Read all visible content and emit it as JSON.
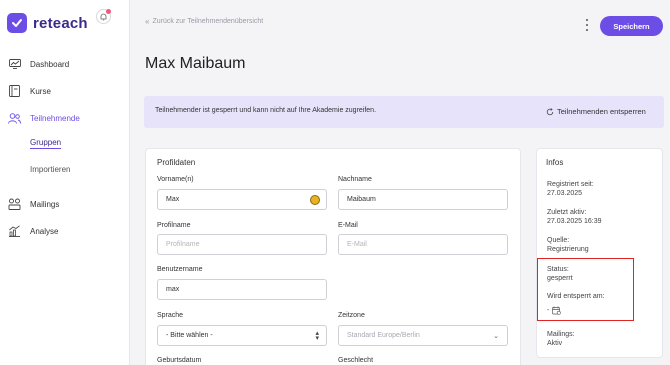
{
  "app": {
    "brand": "reteach"
  },
  "sidebar": {
    "items": [
      {
        "label": "Dashboard",
        "icon": "dashboard-icon"
      },
      {
        "label": "Kurse",
        "icon": "book-icon"
      },
      {
        "label": "Teilnehmende",
        "icon": "users-icon",
        "active": true
      },
      {
        "label": "Mailings",
        "icon": "mailing-icon"
      },
      {
        "label": "Analyse",
        "icon": "analytics-icon"
      }
    ],
    "sub_items": [
      {
        "label": "Gruppen",
        "active": true
      },
      {
        "label": "Importieren"
      }
    ]
  },
  "header": {
    "back_label": "Zurück zur Teilnehmendenübersicht",
    "save_label": "Speichern"
  },
  "page_title": "Max Maibaum",
  "banner": {
    "text": "Teilnehmender ist gesperrt und kann nicht auf Ihre Akademie zugreifen.",
    "action_label": "Teilnehmenden entsperren"
  },
  "profile": {
    "title": "Profildaten",
    "fields": {
      "first_name": {
        "label": "Vorname(n)",
        "value": "Max"
      },
      "last_name": {
        "label": "Nachname",
        "value": "Maibaum"
      },
      "profile_name": {
        "label": "Profilname",
        "placeholder": "Profilname"
      },
      "email": {
        "label": "E-Mail",
        "placeholder": "E-Mail"
      },
      "username": {
        "label": "Benutzername",
        "value": "max"
      },
      "language": {
        "label": "Sprache",
        "value": "- Bitte wählen -"
      },
      "timezone": {
        "label": "Zeitzone",
        "value": "Standard Europe/Berlin"
      },
      "birthdate": {
        "label": "Geburtsdatum"
      },
      "gender": {
        "label": "Geschlecht"
      }
    }
  },
  "info": {
    "title": "Infos",
    "registered_label": "Registriert seit:",
    "registered_value": "27.03.2025",
    "last_active_label": "Zuletzt aktiv:",
    "last_active_value": "27.03.2025 16:39",
    "source_label": "Quelle:",
    "source_value": "Registrierung",
    "status_label": "Status:",
    "status_value": "gesperrt",
    "unlock_date_label": "Wird entsperrt am:",
    "unlock_date_value": "-",
    "mailings_label": "Mailings:",
    "mailings_value": "Aktiv"
  },
  "colors": {
    "accent": "#6c4ee6",
    "banner_bg": "#e7e3fb",
    "highlight": "#e02424"
  }
}
